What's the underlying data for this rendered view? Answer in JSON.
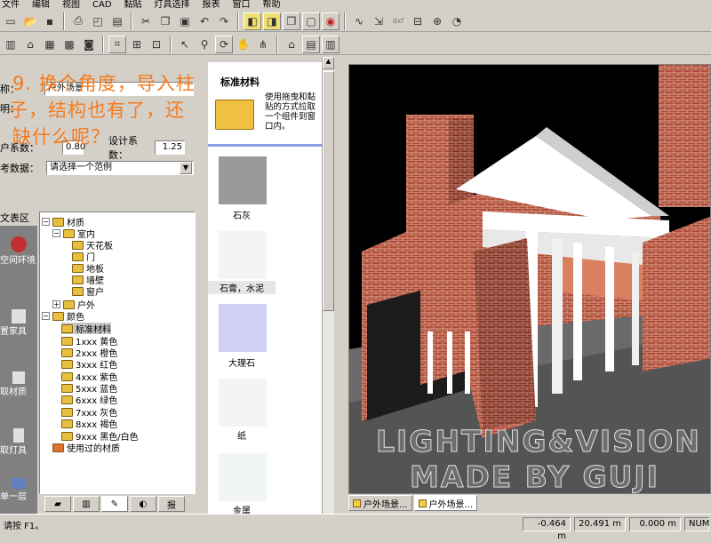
{
  "menu": [
    "文件",
    "编辑",
    "视图",
    "CAD",
    "黏贴",
    "灯具选择",
    "报表",
    "窗口",
    "帮助"
  ],
  "overlay": {
    "line1": "9. 换个角度，导入柱",
    "line2": "子，结构也有了，还",
    "line3": "缺什么呢？"
  },
  "form": {
    "name_label": "称：",
    "name_value": "户外场景",
    "desc_label": "明：",
    "coef_label": "户系数：",
    "coef_value": "0.80",
    "design_coef_label": "设计系数：",
    "design_coef_value": "1.25",
    "ref_label": "考数据：",
    "ref_value": "请选择一个范例"
  },
  "sidebar": {
    "header": "文表区",
    "items": [
      "空间环境",
      "置家具",
      "取材质",
      "取灯具",
      "单一层"
    ]
  },
  "tree": {
    "materials": "材质",
    "indoor": "室内",
    "ceiling": "天花板",
    "door": "门",
    "floor": "地板",
    "wall": "墙壁",
    "window": "窗户",
    "outdoor": "户外",
    "color": "颜色",
    "standard": "标准材料",
    "c1": "1xxx 黄色",
    "c2": "2xxx 橙色",
    "c3": "3xxx 红色",
    "c4": "4xxx 紫色",
    "c5": "5xxx 蓝色",
    "c6": "6xxx 绿色",
    "c7": "7xxx 灰色",
    "c8": "8xxx 褐色",
    "c9": "9xxx 黑色/白色",
    "used": "使用过的材质"
  },
  "bottom_tabs": [
    "报"
  ],
  "material_panel": {
    "title": "标准材料",
    "hint": "使用拖曳和黏贴的方式拉取一个组件到窗口内。",
    "swatches": [
      {
        "label": "石灰",
        "color": "#9a9a9a"
      },
      {
        "label": "石膏，水泥",
        "color": "#f4f4f4"
      },
      {
        "label": "大理石",
        "color": "#d0d0f4"
      },
      {
        "label": "纸",
        "color": "#f4f4f4"
      },
      {
        "label": "金属",
        "color": "#f2f6f2"
      }
    ]
  },
  "watermark": {
    "line1": "LIGHTING&VISION",
    "line2": "MADE BY GUJI"
  },
  "view_tabs": [
    "户外场景...",
    "户外场景..."
  ],
  "status": {
    "hint": "请按 F1。",
    "x": "-0.464 m",
    "y": "20.491 m",
    "z": "0.000 m",
    "num": "NUM"
  },
  "colors": {
    "brick": "#b0503a",
    "brick_dark": "#7a3226",
    "overlay_orange": "#f47b20"
  }
}
